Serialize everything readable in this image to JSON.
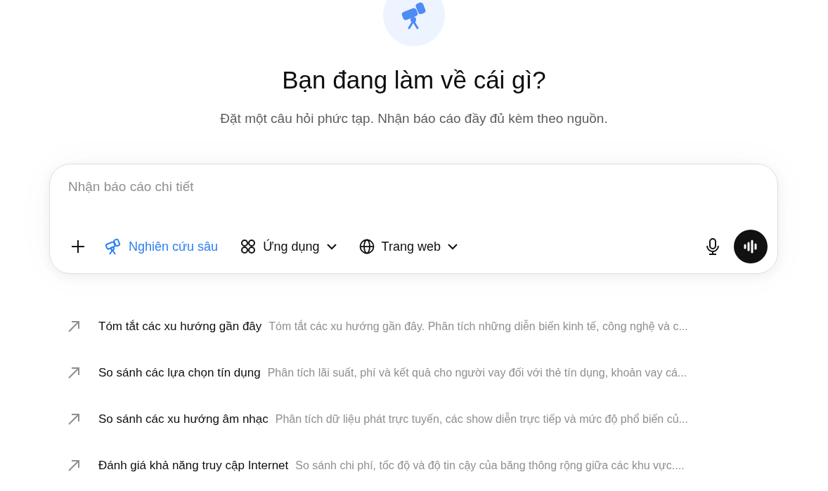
{
  "heading": "Bạn đang làm về cái gì?",
  "subheading": "Đặt một câu hỏi phức tạp. Nhận báo cáo đầy đủ kèm theo nguồn.",
  "composer": {
    "placeholder": "Nhận báo cáo chi tiết",
    "tools": [
      {
        "kind": "research",
        "label": "Nghiên cứu sâu",
        "selected": true
      },
      {
        "kind": "apps",
        "label": "Ứng dụng",
        "selected": false
      },
      {
        "kind": "web",
        "label": "Trang web",
        "selected": false
      }
    ]
  },
  "suggestions": [
    {
      "title": "Tóm tắt các xu hướng gần đây",
      "description": "Tóm tắt các xu hướng gần đây. Phân tích những diễn biến kinh tế, công nghệ và c..."
    },
    {
      "title": "So sánh các lựa chọn tín dụng",
      "description": "Phân tích lãi suất, phí và kết quả cho người vay đối với thẻ tín dụng, khoản vay cá..."
    },
    {
      "title": "So sánh các xu hướng âm nhạc",
      "description": "Phân tích dữ liệu phát trực tuyến, các show diễn trực tiếp và mức độ phổ biến củ..."
    },
    {
      "title": "Đánh giá khả năng truy cập Internet",
      "description": "So sánh chi phí, tốc độ và độ tin cậy của băng thông rộng giữa các khu vực...."
    }
  ]
}
